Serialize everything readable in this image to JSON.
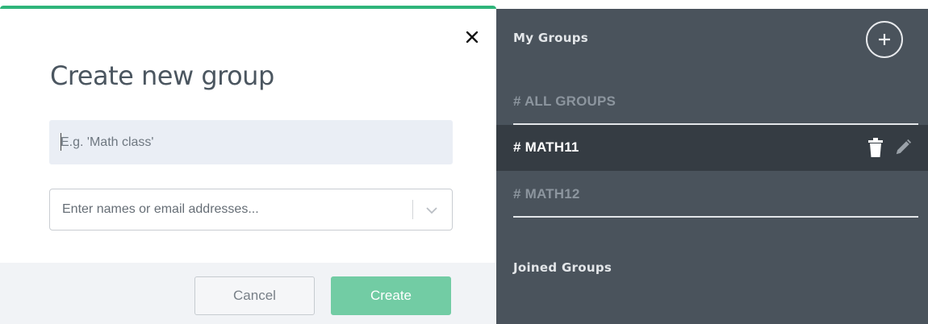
{
  "modal": {
    "title": "Create new group",
    "name_input": {
      "value": "",
      "placeholder": "E.g. 'Math class'"
    },
    "members_select": {
      "placeholder": "Enter names or email addresses..."
    },
    "buttons": {
      "cancel": "Cancel",
      "create": "Create"
    },
    "accent_color": "#2fb57a"
  },
  "sidebar": {
    "my_groups_label": "My Groups",
    "joined_groups_label": "Joined Groups",
    "groups": [
      {
        "label": "# ALL GROUPS",
        "active": false
      },
      {
        "label": "# MATH11",
        "active": true
      },
      {
        "label": "# MATH12",
        "active": false
      }
    ],
    "icons": {
      "add": "plus-circle-icon",
      "delete": "trash-icon",
      "edit": "pencil-icon",
      "close": "close-icon",
      "dropdown": "chevron-down-icon"
    }
  }
}
